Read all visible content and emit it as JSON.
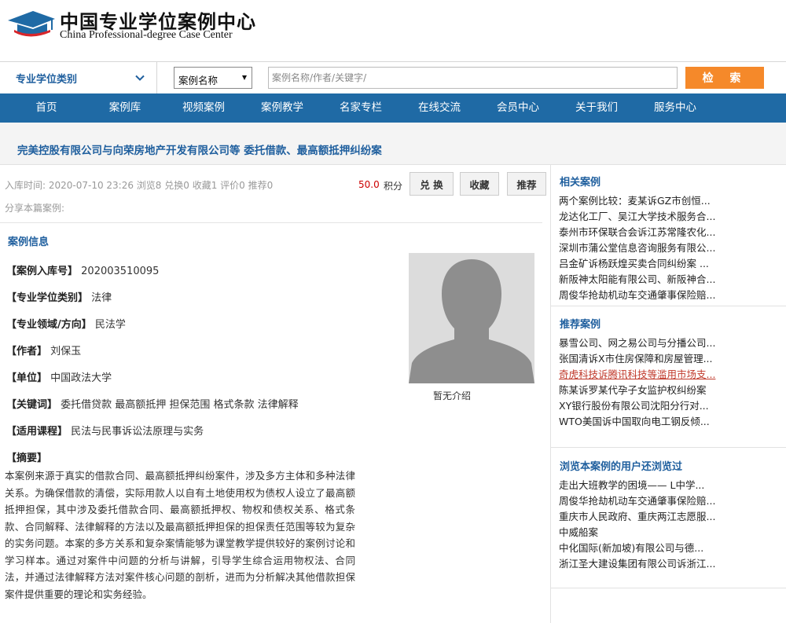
{
  "header": {
    "title_cn": "中国专业学位案例中心",
    "title_en": "China Professional-degree Case Center"
  },
  "search": {
    "category_label": "专业学位类别",
    "type_selected": "案例名称",
    "placeholder": "案例名称/作者/关键字/",
    "button_label": "检 索"
  },
  "nav": {
    "items": [
      "首页",
      "案例库",
      "视频案例",
      "案例教学",
      "名家专栏",
      "在线交流",
      "会员中心",
      "关于我们",
      "服务中心"
    ]
  },
  "case": {
    "title": "完美控股有限公司与向荣房地产开发有限公司等 委托借款、最高额抵押纠纷案",
    "meta": "入库时间: 2020-07-10 23:26   浏览8  兑换0  收藏1  评价0  推荐0",
    "points": "50.0",
    "points_unit": "积分",
    "btn_exchange": "兑 换",
    "btn_favorite": "收藏",
    "btn_recommend": "推荐",
    "share_label": "分享本篇案例:",
    "info_header": "案例信息",
    "fields": [
      {
        "key": "【案例入库号】",
        "value": "202003510095"
      },
      {
        "key": "【专业学位类别】",
        "value": "法律"
      },
      {
        "key": "【专业领域/方向】",
        "value": "民法学"
      },
      {
        "key": "【作者】",
        "value": "刘保玉"
      },
      {
        "key": "【单位】",
        "value": "中国政法大学"
      },
      {
        "key": "【关键词】",
        "value": "委托借贷款 最高额抵押 担保范围 格式条款 法律解释"
      },
      {
        "key": "【适用课程】",
        "value": "民法与民事诉讼法原理与实务"
      }
    ],
    "summary_key": "【摘要】",
    "summary": "本案例来源于真实的借款合同、最高额抵押纠纷案件，涉及多方主体和多种法律关系。为确保借款的清偿，实际用款人以自有土地使用权为债权人设立了最高额抵押担保，其中涉及委托借款合同、最高额抵押权、物权和债权关系、格式条款、合同解释、法律解释的方法以及最高额抵押担保的担保责任范围等较为复杂的实务问题。本案的多方关系和复杂案情能够为课堂教学提供较好的案例讨论和学习样本。通过对案件中问题的分析与讲解，引导学生综合运用物权法、合同法，并通过法律解释方法对案件核心问题的剖析，进而为分析解决其他借款担保案件提供重要的理论和实务经验。",
    "no_intro": "暂无介绍"
  },
  "sidebar": {
    "related": {
      "title": "相关案例",
      "items": [
        "两个案例比较：麦某诉GZ市创恒...",
        "龙达化工厂、吴江大学技术服务合...",
        "泰州市环保联合会诉江苏常隆农化...",
        "深圳市蒲公堂信息咨询服务有限公...",
        "吕金矿诉杨跃煌买卖合同纠纷案 ...",
        "新阪神太阳能有限公司、新阪神合...",
        "周俊华抢劫机动车交通肇事保险赔..."
      ]
    },
    "recommended": {
      "title": "推荐案例",
      "items": [
        "暴雪公司、网之易公司与分播公司...",
        "张国清诉X市住房保障和房屋管理...",
        "奇虎科技诉腾讯科技等滥用市场支...",
        "陈某诉罗某代孕子女监护权纠纷案",
        "XY银行股份有限公司沈阳分行对...",
        "WTO美国诉中国取向电工钢反倾..."
      ],
      "active_index": 2
    },
    "also_viewed": {
      "title": "浏览本案例的用户还浏览过",
      "items": [
        "走出大班教学的困境—— L中学...",
        "周俊华抢劫机动车交通肇事保险赔...",
        "重庆市人民政府、重庆两江志愿服...",
        "中威船案",
        "中化国际(新加坡)有限公司与德...",
        "浙江圣大建设集团有限公司诉浙江..."
      ]
    }
  },
  "colors": {
    "nav_bg": "#1f6aa5",
    "accent_blue": "#1f5f9e",
    "search_button": "#f5892a",
    "points_red": "#cc0000",
    "active_link": "#c0392b"
  }
}
